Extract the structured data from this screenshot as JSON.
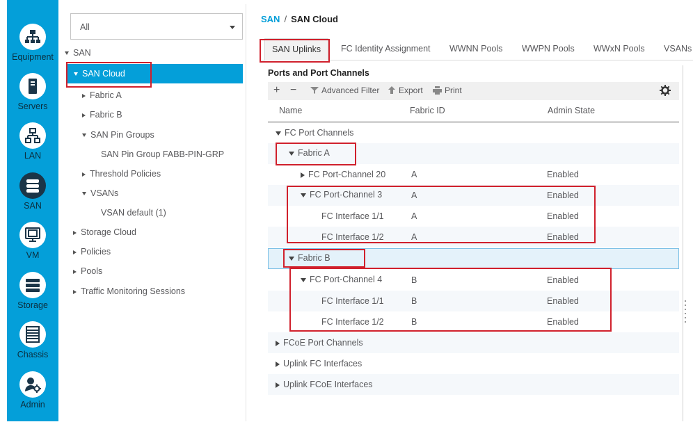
{
  "nav": {
    "items": [
      {
        "label": "Equipment",
        "icon": "equipment-icon"
      },
      {
        "label": "Servers",
        "icon": "server-icon"
      },
      {
        "label": "LAN",
        "icon": "lan-icon"
      },
      {
        "label": "SAN",
        "icon": "san-icon",
        "active": true
      },
      {
        "label": "VM",
        "icon": "vm-icon"
      },
      {
        "label": "Storage",
        "icon": "storage-icon"
      },
      {
        "label": "Chassis",
        "icon": "chassis-icon"
      },
      {
        "label": "Admin",
        "icon": "admin-icon"
      }
    ]
  },
  "tree": {
    "filter_value": "All",
    "items": [
      {
        "label": "SAN",
        "expanded": true
      },
      {
        "label": "SAN Cloud",
        "expanded": true,
        "selected": true
      },
      {
        "label": "Fabric A",
        "expanded": false
      },
      {
        "label": "Fabric B",
        "expanded": false
      },
      {
        "label": "SAN Pin Groups",
        "expanded": true
      },
      {
        "label": "SAN Pin Group FABB-PIN-GRP"
      },
      {
        "label": "Threshold Policies",
        "expanded": false
      },
      {
        "label": "VSANs",
        "expanded": true
      },
      {
        "label": "VSAN default (1)"
      },
      {
        "label": "Storage Cloud",
        "expanded": false
      },
      {
        "label": "Policies",
        "expanded": false
      },
      {
        "label": "Pools",
        "expanded": false
      },
      {
        "label": "Traffic Monitoring Sessions",
        "expanded": false
      }
    ]
  },
  "breadcrumb": {
    "root": "SAN",
    "separator": "/",
    "current": "SAN Cloud"
  },
  "tabs": [
    {
      "label": "SAN Uplinks",
      "active": true
    },
    {
      "label": "FC Identity Assignment"
    },
    {
      "label": "WWNN Pools"
    },
    {
      "label": "WWPN Pools"
    },
    {
      "label": "WWxN Pools"
    },
    {
      "label": "VSANs"
    }
  ],
  "section": {
    "title": "Ports and Port Channels"
  },
  "toolbar": {
    "add_symbol": "+",
    "remove_symbol": "−",
    "filter_label": "Advanced Filter",
    "export_label": "Export",
    "print_label": "Print"
  },
  "grid": {
    "columns": [
      "Name",
      "Fabric ID",
      "Admin State"
    ],
    "rows": [
      {
        "name": "FC Port Channels",
        "fabric": "",
        "state": "",
        "expanded": true
      },
      {
        "name": "Fabric A",
        "fabric": "",
        "state": "",
        "expanded": true
      },
      {
        "name": "FC Port-Channel 20",
        "fabric": "A",
        "state": "Enabled",
        "expanded": false
      },
      {
        "name": "FC Port-Channel 3",
        "fabric": "A",
        "state": "Enabled",
        "expanded": true
      },
      {
        "name": "FC Interface 1/1",
        "fabric": "A",
        "state": "Enabled"
      },
      {
        "name": "FC Interface 1/2",
        "fabric": "A",
        "state": "Enabled"
      },
      {
        "name": "Fabric B",
        "fabric": "",
        "state": "",
        "expanded": true,
        "highlighted": true
      },
      {
        "name": "FC Port-Channel 4",
        "fabric": "B",
        "state": "Enabled",
        "expanded": true
      },
      {
        "name": "FC Interface 1/1",
        "fabric": "B",
        "state": "Enabled"
      },
      {
        "name": "FC Interface 1/2",
        "fabric": "B",
        "state": "Enabled"
      },
      {
        "name": "FCoE Port Channels",
        "fabric": "",
        "state": "",
        "expanded": false
      },
      {
        "name": "Uplink FC Interfaces",
        "fabric": "",
        "state": "",
        "expanded": false
      },
      {
        "name": "Uplink FCoE Interfaces",
        "fabric": "",
        "state": "",
        "expanded": false
      }
    ]
  },
  "colors": {
    "accent": "#049fd9",
    "rail_bg": "#049fd9",
    "annotation_red": "#d0202c",
    "active_icon_bg": "#1b3548"
  }
}
